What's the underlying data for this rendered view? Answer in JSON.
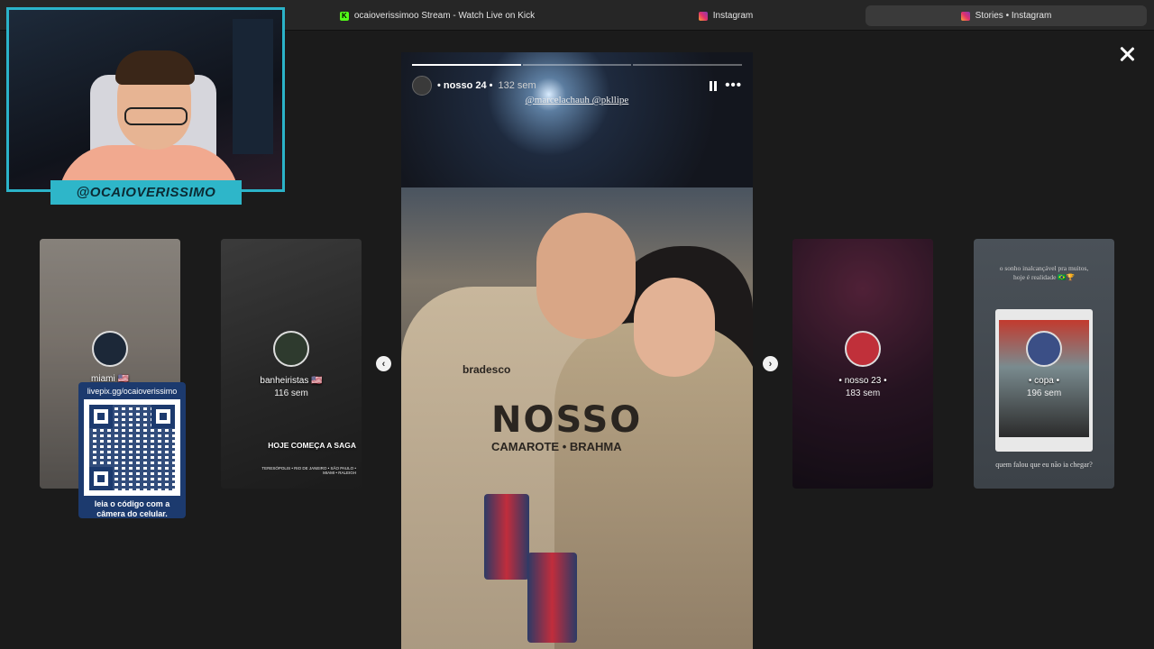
{
  "browser": {
    "tabs": [
      {
        "label": "ocaioverissimoo Stream - Watch Live on Kick",
        "favicon": "kick-icon",
        "active": false
      },
      {
        "label": "Instagram",
        "favicon": "instagram-icon",
        "active": false
      },
      {
        "label": "Stories • Instagram",
        "favicon": "instagram-icon",
        "active": true
      }
    ]
  },
  "webcam": {
    "channel_name": "@OCAIOVERISSIMO"
  },
  "story": {
    "username": "• nosso 24 •",
    "time": "132 sem",
    "mentions": "@marcelachauh @pkllipe",
    "progress_segments": 1
  },
  "side_stories": [
    {
      "name": "miami 🇺🇸",
      "age": ""
    },
    {
      "name": "banheiristas 🇺🇸",
      "age": "116 sem",
      "caption": "HOJE COMEÇA A SAGA",
      "caption_sub": "TERESÓPOLIS • RIO DE JANEIRO • SÃO PAULO • MIAMI • RALEIGH"
    },
    {
      "name": "• nosso 23 •",
      "age": "183 sem"
    },
    {
      "name": "• copa •",
      "age": "196 sem",
      "caption_top": "o sonho inalcançável pra muitos, hoje é realidade 🇧🇷🏆",
      "caption_bottom": "quem falou que eu não ia chegar?"
    }
  ],
  "qr_overlay": {
    "url": "livepix.gg/ocaioverissimo",
    "instruction": "leia o código com a câmera do celular."
  },
  "icons": {
    "close": "close-icon",
    "pause": "pause-icon",
    "more": "more-options-icon",
    "prev": "chevron-left-icon",
    "next": "chevron-right-icon"
  }
}
